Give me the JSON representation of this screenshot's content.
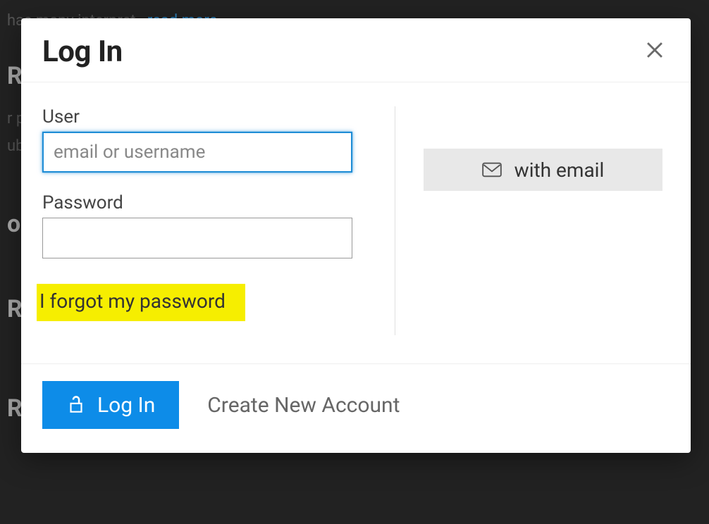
{
  "background": {
    "line1a": "has many interpret",
    "line1b": "read more",
    "h1": "RS",
    "line2a": "r p",
    "line2b": "ubl",
    "h2": "o",
    "h3": " R",
    "h4": "RC"
  },
  "modal": {
    "title": "Log In",
    "close_aria": "Close",
    "user_label": "User",
    "user_placeholder": "email or username",
    "password_label": "Password",
    "forgot_text": "I forgot my password",
    "email_button": "with email",
    "login_button": "Log In",
    "create_account": "Create New Account"
  }
}
